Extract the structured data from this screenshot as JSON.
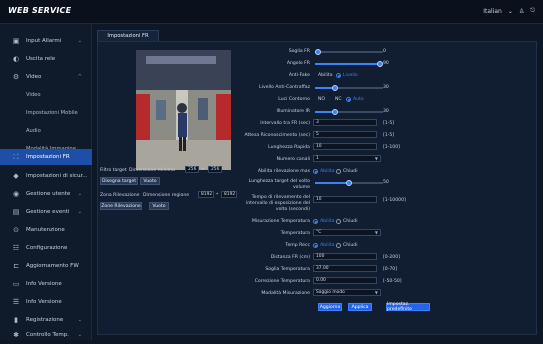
{
  "app": {
    "brand": "WEB SERVICE",
    "user": "Italian",
    "colors": {
      "accent": "#3b82f6",
      "active_bg": "#1e4fa8",
      "bg": "#0e1726"
    }
  },
  "topbar": {
    "user_label": "Italian",
    "icons": [
      "chevron-down-icon",
      "user-icon",
      "logout-icon"
    ]
  },
  "sidebar": {
    "items": [
      {
        "label": "Input Allarmi",
        "icon": "alarm-input-icon",
        "arrow": "⌄"
      },
      {
        "label": "Uscita rele",
        "icon": "relay-icon",
        "arrow": ""
      },
      {
        "label": "Video",
        "icon": "video-icon",
        "arrow": "^"
      },
      {
        "label": "Video",
        "sub": true
      },
      {
        "label": "Impostazioni Mobile",
        "sub": true
      },
      {
        "label": "Audio",
        "sub": true
      },
      {
        "label": "Modalità Immagine",
        "sub": true
      },
      {
        "label": "Impostazioni FR",
        "icon": "fr-icon",
        "active": true
      },
      {
        "label": "Impostazioni di sicur...",
        "icon": "shield-icon",
        "arrow": "⌄"
      },
      {
        "label": "Gestione utente",
        "icon": "users-icon",
        "arrow": "⌄"
      },
      {
        "label": "Gestione eventi",
        "icon": "event-icon",
        "arrow": "⌄"
      },
      {
        "label": "Manutenzione",
        "icon": "maintenance-icon",
        "arrow": ""
      },
      {
        "label": "Configurazione",
        "icon": "config-icon",
        "arrow": ""
      },
      {
        "label": "Aggiornamento FW",
        "icon": "upgrade-icon",
        "arrow": ""
      },
      {
        "label": "Info Versione",
        "icon": "info-icon",
        "arrow": ""
      },
      {
        "label": "Info Versione",
        "icon": "log-icon",
        "arrow": ""
      },
      {
        "label": "Registrazione",
        "icon": "record-icon",
        "arrow": "⌄"
      },
      {
        "label": "Controllo Temp.",
        "icon": "temp-icon",
        "arrow": "⌄"
      }
    ]
  },
  "tab": {
    "label": "Impostazioni FR"
  },
  "left_controls": {
    "filter_label": "Filtro target",
    "min_size_label": "Dimensione minima",
    "min_w": "256",
    "times": "*",
    "min_h": "256",
    "draw_target_button": "Disegna target",
    "clear_button": "Vuoto",
    "detect_zone_label": "Zona Rilevazione",
    "detect_zone_size_label": "Dimensione regione",
    "zone_w": "8192",
    "zone_h": "8192",
    "draw_detect_button": "Zone Rilevazione",
    "clear_button_2": "Vuoto"
  },
  "settings": {
    "fr_threshold": {
      "label": "Soglia FR",
      "value": "0",
      "fraction": 0.02
    },
    "fr_angle": {
      "label": "Angolo FR",
      "value": "90",
      "fraction": 0.97
    },
    "anti_fake": {
      "label": "Anti-Fake",
      "opt_off": "Abilita",
      "opt_on": "Livello",
      "selected": "Livello"
    },
    "fake_level": {
      "label": "Livello Anti-Contraffaz",
      "value": "30",
      "fraction": 0.3
    },
    "led": {
      "label": "Luci Contorno",
      "opt1": "NO",
      "opt2": "NC",
      "opt3": "Auto",
      "selected": "Auto"
    },
    "ir_light": {
      "label": "Illuminatore IR",
      "value": "30",
      "fraction": 0.3
    },
    "fr_interval": {
      "label": "Intervallo tra FR (sec)",
      "value": "3",
      "range": "[1-5]"
    },
    "unlock_interval": {
      "label": "Attesa Riconoscimento (sec)",
      "value": "5",
      "range": "[1-5]"
    },
    "rapid_reading": {
      "label": "Lunghezza Rapida",
      "value": "10",
      "range": "[1-100]"
    },
    "channels": {
      "label": "Numero canali",
      "value": "1"
    },
    "mask_detect": {
      "label": "Abilita rilevazione mas",
      "opt_on": "Abilita",
      "opt_off": "Chiudi",
      "selected": "Abilita"
    },
    "mask_threshold": {
      "label": "Lunghezza target del volto",
      "label2": "volume",
      "value": "50",
      "fraction": 0.5
    },
    "mask_time": {
      "label": "Tempo di rilevamento del",
      "label2": "intervallo di esposizione del",
      "label3": "volto (secondi)",
      "value": "10",
      "range": "[1-10000]"
    },
    "temp_mode": {
      "label": "Misurazione Temperatura",
      "opt_on": "Abilita",
      "opt_off": "Chiudi",
      "selected": "Abilita"
    },
    "temp_type": {
      "label": "Temperatura",
      "value": "°C"
    },
    "temp_fast": {
      "label": "Temp Recc",
      "opt_on": "Abilita",
      "opt_off": "Chiudi",
      "selected": "Abilita"
    },
    "fr_distance": {
      "label": "Distanza FR (cm)",
      "value": "100",
      "range": "[0-200]"
    },
    "temp_threshold": {
      "label": "Soglia Temperatura",
      "value": "37.00",
      "range": "[0-70]"
    },
    "temp_correction": {
      "label": "Correzione Temperatura",
      "value": "0.00",
      "range": "[-50-50]"
    },
    "mode": {
      "label": "Modalità Misurazione",
      "value": "Saggio modo"
    }
  },
  "footer": {
    "refresh": "Aggiorna",
    "apply": "Applica",
    "default": "Impostaz. predefinite"
  }
}
